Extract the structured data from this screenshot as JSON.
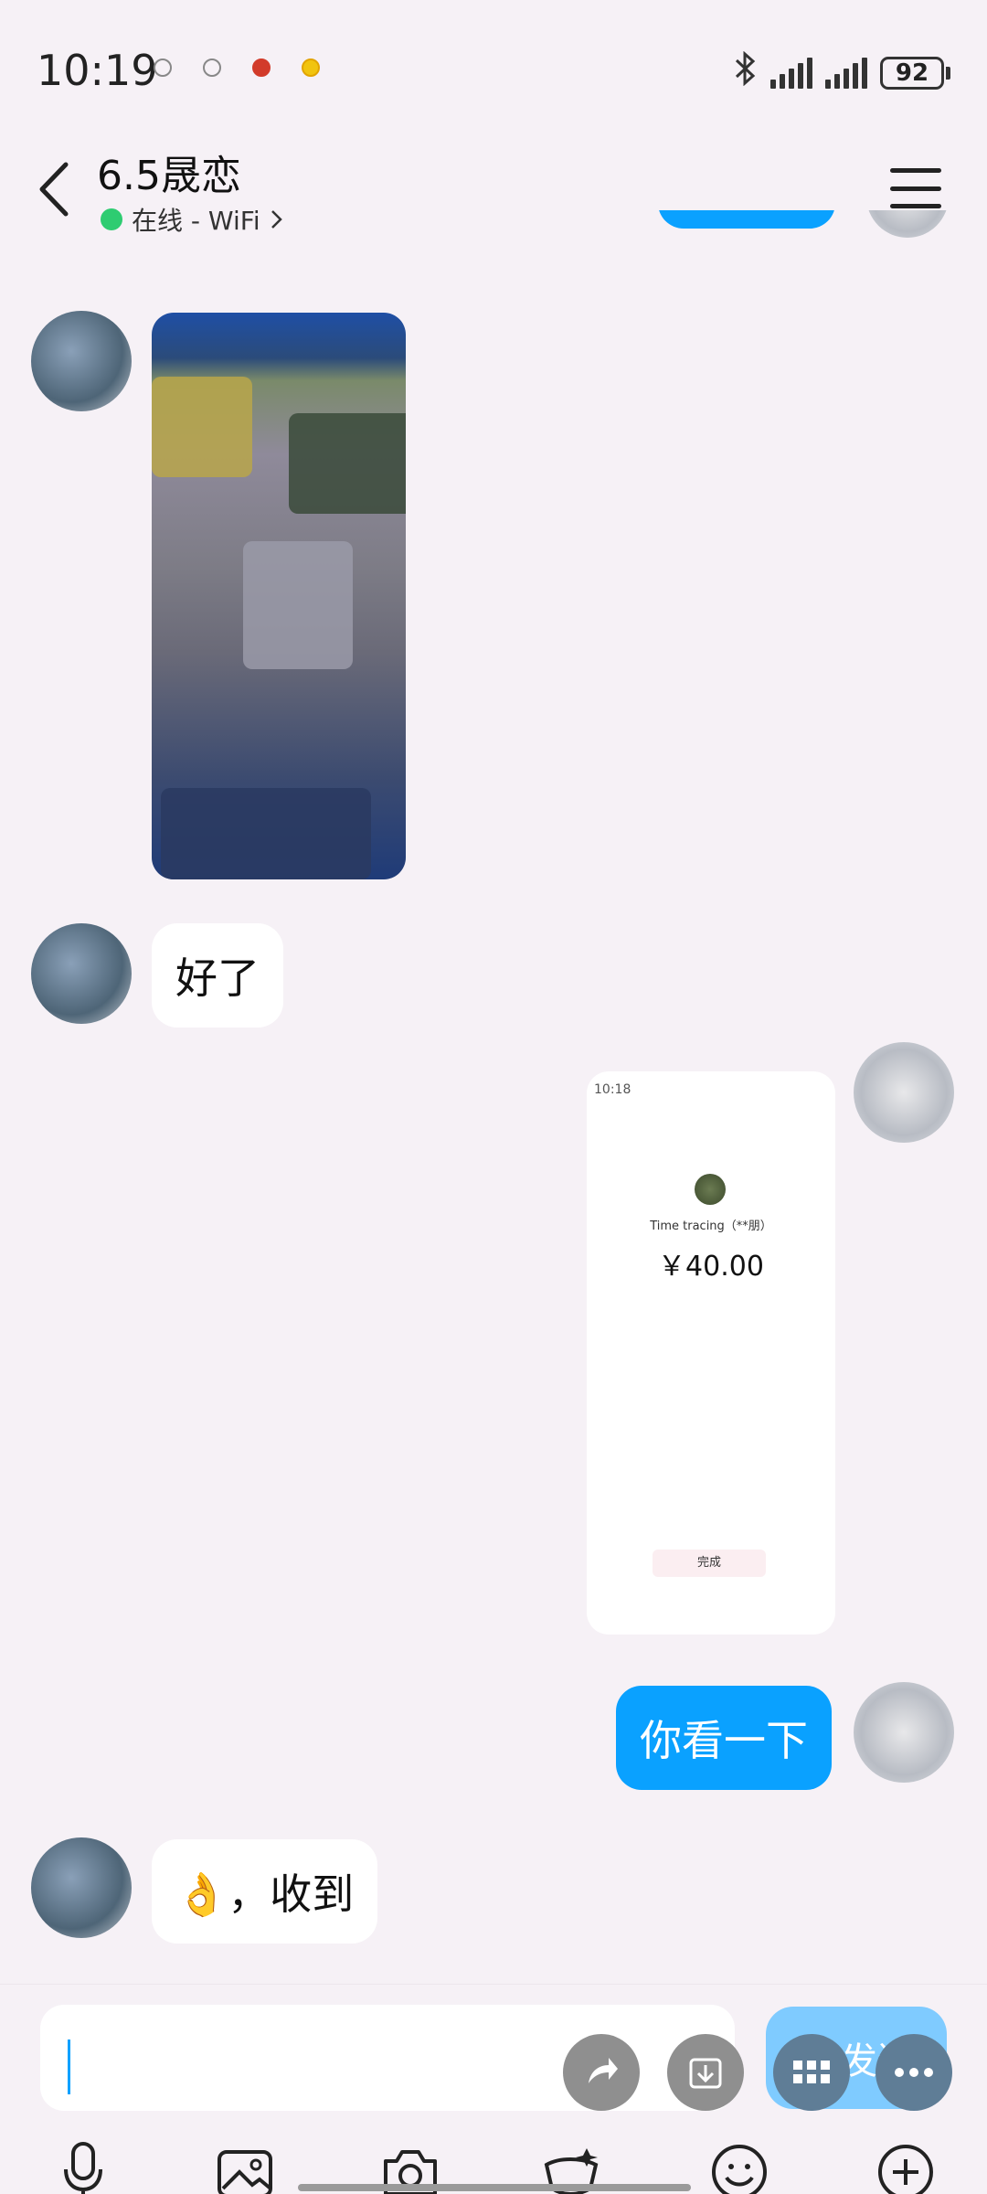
{
  "status_bar": {
    "time": "10:19",
    "battery": "92",
    "icons": [
      "notification-icon",
      "notification-icon",
      "weibo-icon",
      "emoji-icon",
      "bluetooth-icon",
      "signal-icon",
      "signal-icon",
      "battery-icon"
    ]
  },
  "header": {
    "contact_name": "6.5晟恋",
    "online_status": "在线 - WiFi",
    "icons": [
      "back-icon",
      "menu-icon"
    ]
  },
  "messages": [
    {
      "direction": "incoming",
      "type": "image",
      "content": "game screenshot (obscured)"
    },
    {
      "direction": "incoming",
      "type": "text",
      "text": "好了"
    },
    {
      "direction": "outgoing",
      "type": "image",
      "content": "payment screenshot"
    },
    {
      "direction": "outgoing",
      "type": "text",
      "text": "你看一下"
    },
    {
      "direction": "incoming",
      "type": "text",
      "text": "👌，收到"
    }
  ],
  "payment_screenshot": {
    "status_time": "10:18",
    "payee": "Time tracing（**朋）",
    "amount": "￥40.00",
    "done_button": "完成"
  },
  "input": {
    "value": "",
    "send_label": "发送",
    "toolbar_icons": [
      "microphone-icon",
      "image-icon",
      "camera-icon",
      "red-packet-icon",
      "emoji-icon",
      "plus-icon"
    ],
    "floating_icons": [
      "share-icon",
      "download-icon",
      "grid-icon",
      "more-icon"
    ]
  },
  "colors": {
    "background": "#f6f1f6",
    "outgoing_bubble": "#0aa1ff",
    "incoming_bubble": "#ffffff",
    "online_dot": "#2ecc71"
  }
}
